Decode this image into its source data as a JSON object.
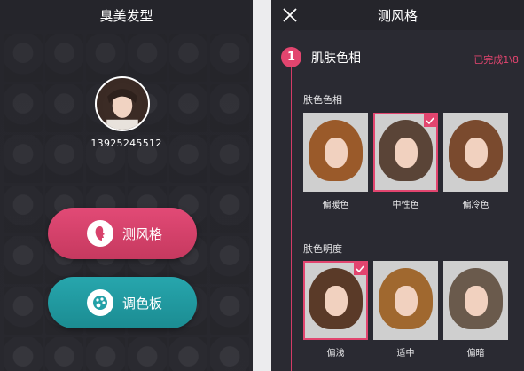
{
  "left_screen": {
    "title": "臭美发型",
    "avatar_icon": "user-avatar",
    "phone_number": "13925245512",
    "buttons": {
      "test_style": {
        "label": "测风格",
        "icon": "face-profile-icon",
        "color": "#d8426b"
      },
      "palette": {
        "label": "调色板",
        "icon": "palette-icon",
        "color": "#22a0a7"
      }
    }
  },
  "right_screen": {
    "title": "测风格",
    "close_icon": "close-icon",
    "step": {
      "number": "1",
      "title": "肌肤色相",
      "status": "已完成1\\8",
      "accent": "#e2456f"
    },
    "sections": [
      {
        "label": "肤色色相",
        "options": [
          {
            "caption": "偏暖色",
            "selected": false
          },
          {
            "caption": "中性色",
            "selected": true
          },
          {
            "caption": "偏冷色",
            "selected": false
          }
        ]
      },
      {
        "label": "肤色明度",
        "options": [
          {
            "caption": "偏浅",
            "selected": true
          },
          {
            "caption": "适中",
            "selected": false
          },
          {
            "caption": "偏暗",
            "selected": false
          }
        ]
      }
    ]
  }
}
